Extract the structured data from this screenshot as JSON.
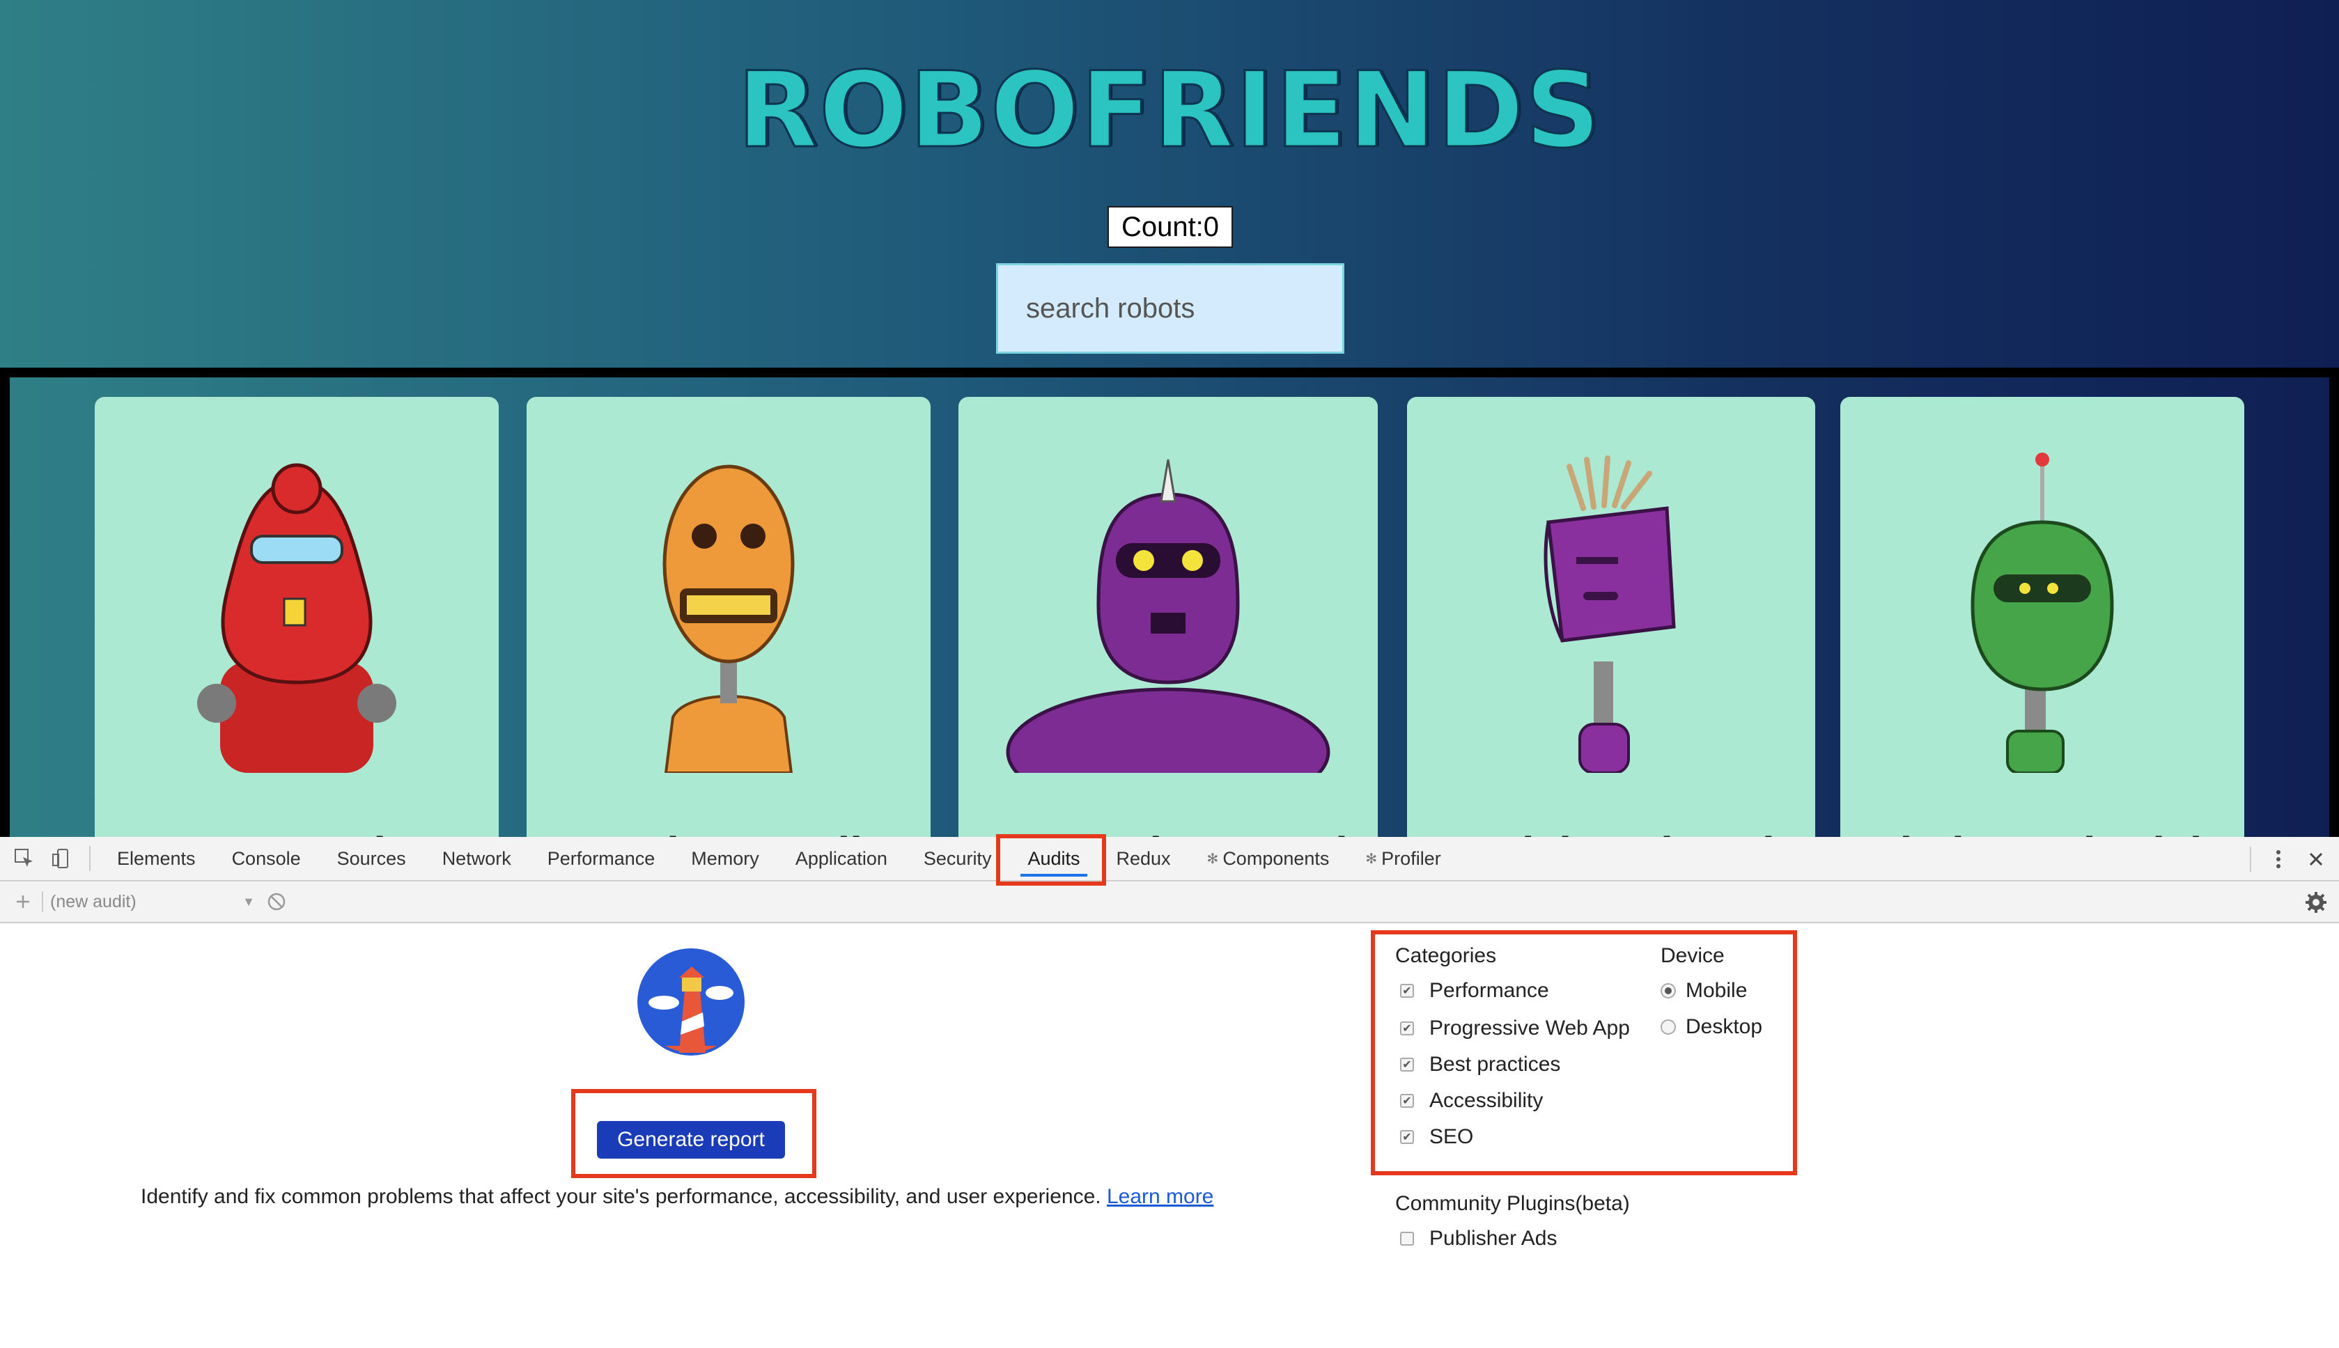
{
  "app": {
    "logo": "ROBOFRIENDS",
    "count_label": "Count:0",
    "search_placeholder": "search robots",
    "robots": [
      {
        "name": "Leanne Graham",
        "color": "#d92b2b"
      },
      {
        "name": "Ervin Howell",
        "color": "#ee9a3a"
      },
      {
        "name": "Clementine Bauch",
        "color": "#7d2c93"
      },
      {
        "name": "Patricia Lebsack",
        "color": "#8a2f9e"
      },
      {
        "name": "Chelsey Dietrich",
        "color": "#46a548"
      }
    ]
  },
  "devtools": {
    "tabs": [
      "Elements",
      "Console",
      "Sources",
      "Network",
      "Performance",
      "Memory",
      "Application",
      "Security",
      "Audits",
      "Redux",
      "Components",
      "Profiler"
    ],
    "active_tab": "Audits",
    "audit_select": "(new audit)",
    "generate_button": "Generate report",
    "description": "Identify and fix common problems that affect your site's performance, accessibility, and user experience.",
    "learn_more": "Learn more",
    "categories_heading": "Categories",
    "categories": [
      "Performance",
      "Progressive Web App",
      "Best practices",
      "Accessibility",
      "SEO"
    ],
    "device_heading": "Device",
    "devices": [
      "Mobile",
      "Desktop"
    ],
    "selected_device": "Mobile",
    "plugins_heading": "Community Plugins(beta)",
    "plugins": [
      "Publisher Ads"
    ]
  },
  "colors": {
    "highlight": "#e5391e",
    "button": "#1a3cb8",
    "card": "#abe9d2",
    "logo": "#2bc4c0"
  }
}
